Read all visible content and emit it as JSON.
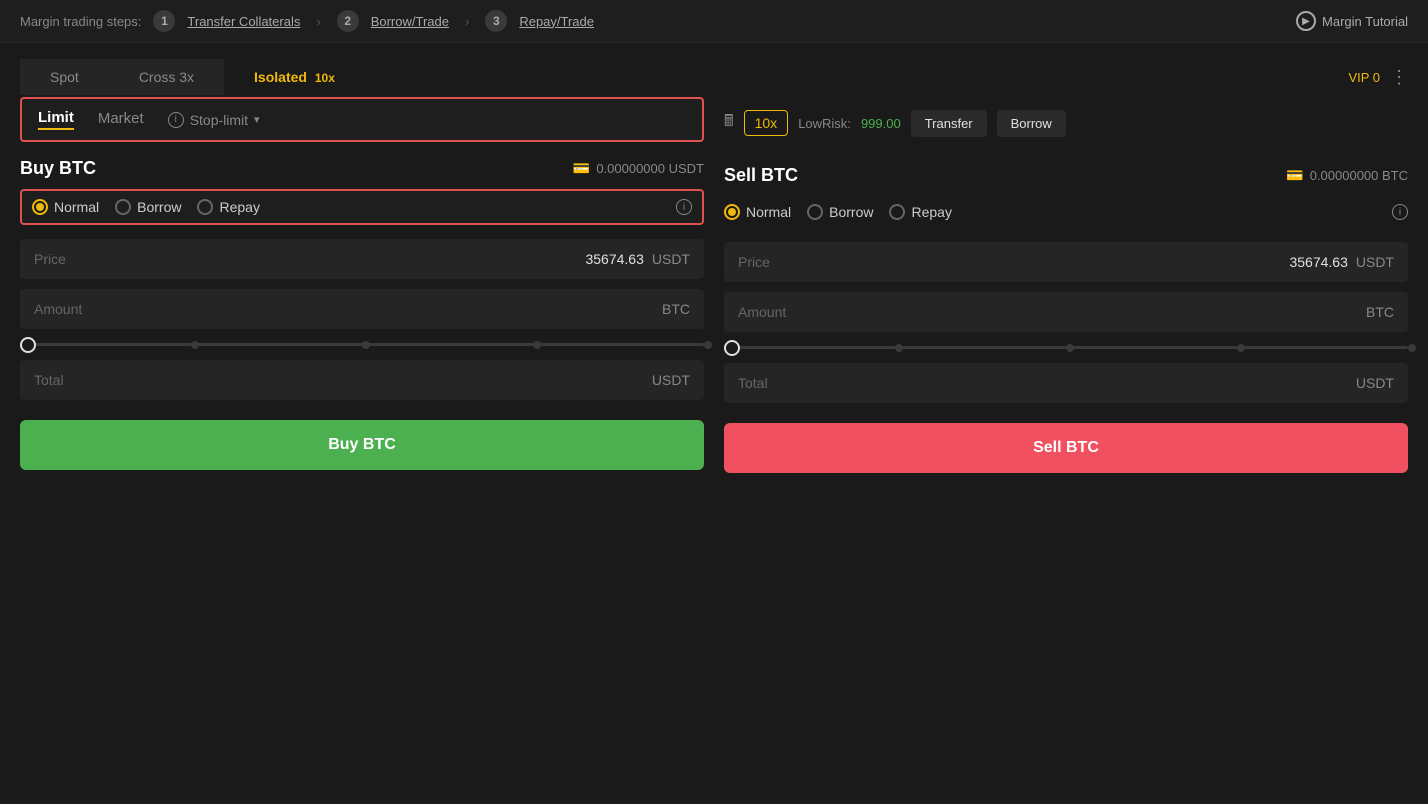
{
  "topbar": {
    "label": "Margin trading steps:",
    "steps": [
      {
        "num": "1",
        "label": "Transfer Collaterals"
      },
      {
        "num": "2",
        "label": "Borrow/Trade"
      },
      {
        "num": "3",
        "label": "Repay/Trade"
      }
    ],
    "tutorial": "Margin Tutorial"
  },
  "tabs": {
    "spot": "Spot",
    "cross": "Cross 3x",
    "isolated": "Isolated",
    "isolated_badge": "10x",
    "vip": "VIP 0"
  },
  "toolbar": {
    "leverage": "10x",
    "lowrisk_label": "LowRisk:",
    "lowrisk_value": "999.00",
    "transfer_label": "Transfer",
    "borrow_label": "Borrow"
  },
  "buy_panel": {
    "title": "Buy BTC",
    "balance": "0.00000000 USDT",
    "order_types": {
      "limit": "Limit",
      "market": "Market",
      "stop_limit": "Stop-limit"
    },
    "radio_options": [
      "Normal",
      "Borrow",
      "Repay"
    ],
    "selected_radio": "Normal",
    "price_label": "Price",
    "price_value": "35674.63",
    "price_unit": "USDT",
    "amount_label": "Amount",
    "amount_unit": "BTC",
    "total_label": "Total",
    "total_unit": "USDT",
    "action": "Buy BTC"
  },
  "sell_panel": {
    "title": "Sell BTC",
    "balance": "0.00000000 BTC",
    "radio_options": [
      "Normal",
      "Borrow",
      "Repay"
    ],
    "selected_radio": "Normal",
    "price_label": "Price",
    "price_value": "35674.63",
    "price_unit": "USDT",
    "amount_label": "Amount",
    "amount_unit": "BTC",
    "total_label": "Total",
    "total_unit": "USDT",
    "action": "Sell BTC"
  }
}
